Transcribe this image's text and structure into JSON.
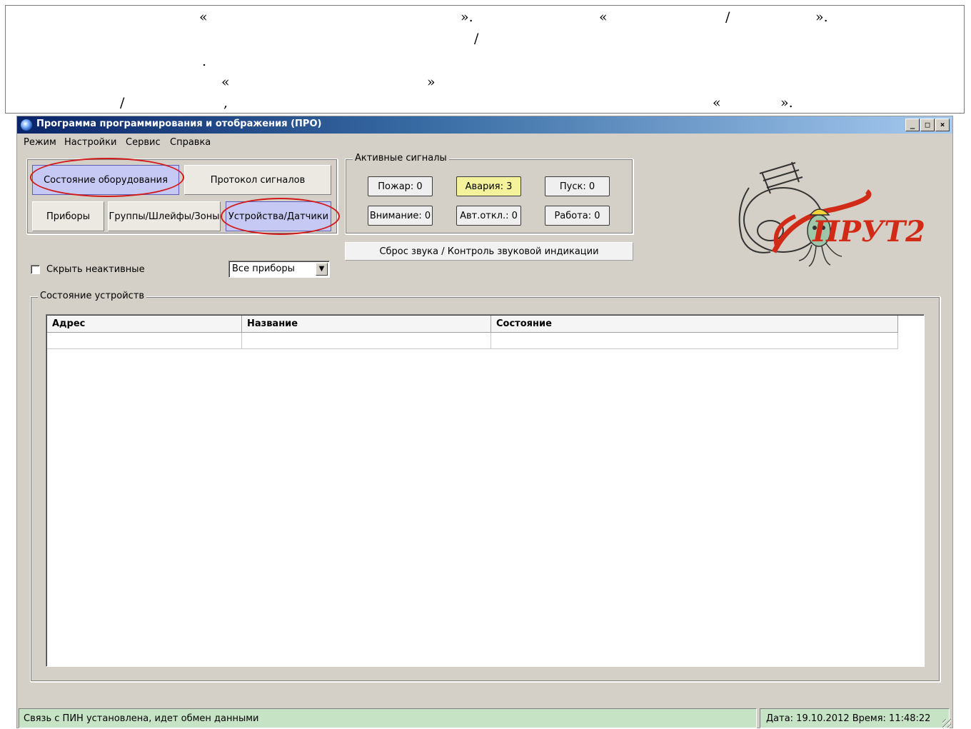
{
  "doc_fragment": {
    "marks": [
      "«",
      "».",
      "«",
      "/",
      "».",
      "/",
      ".",
      "«",
      "»",
      "/",
      ",",
      "«",
      "»."
    ]
  },
  "window": {
    "title": "Программа программирования и отображения (ПРО)",
    "controls": {
      "minimize": "_",
      "maximize": "□",
      "close": "×"
    }
  },
  "menu": [
    "Режим",
    "Настройки",
    "Сервис",
    "Справка"
  ],
  "nav": {
    "equipment_state": "Состояние оборудования",
    "signal_log": "Протокол сигналов",
    "devices": "Приборы",
    "groups": "Группы/Шлейфы/Зоны",
    "sensors": "Устройства/Датчики"
  },
  "signals": {
    "legend": "Активные сигналы",
    "fire": "Пожар: 0",
    "fault": "Авария: 3",
    "start": "Пуск: 0",
    "attention": "Внимание: 0",
    "auto_off": "Авт.откл.: 0",
    "work": "Работа: 0",
    "alert_color": "#f4f29a"
  },
  "reset_button": "Сброс звука / Контроль звуковой индикации",
  "filter": {
    "hide_inactive": "Скрыть неактивные",
    "hide_inactive_checked": false,
    "device_select": "Все приборы"
  },
  "device_state": {
    "legend": "Состояние устройств",
    "columns": [
      "Адрес",
      "Название",
      "Состояние"
    ],
    "rows": []
  },
  "status": {
    "connection": "Связь с ПИН установлена, идет обмен данными",
    "datetime": "Дата: 19.10.2012  Время: 11:48:22"
  },
  "logo": {
    "text": "ПРУТ2",
    "icon": "firefighter-octopus-mascot",
    "color": "#d12a16"
  }
}
